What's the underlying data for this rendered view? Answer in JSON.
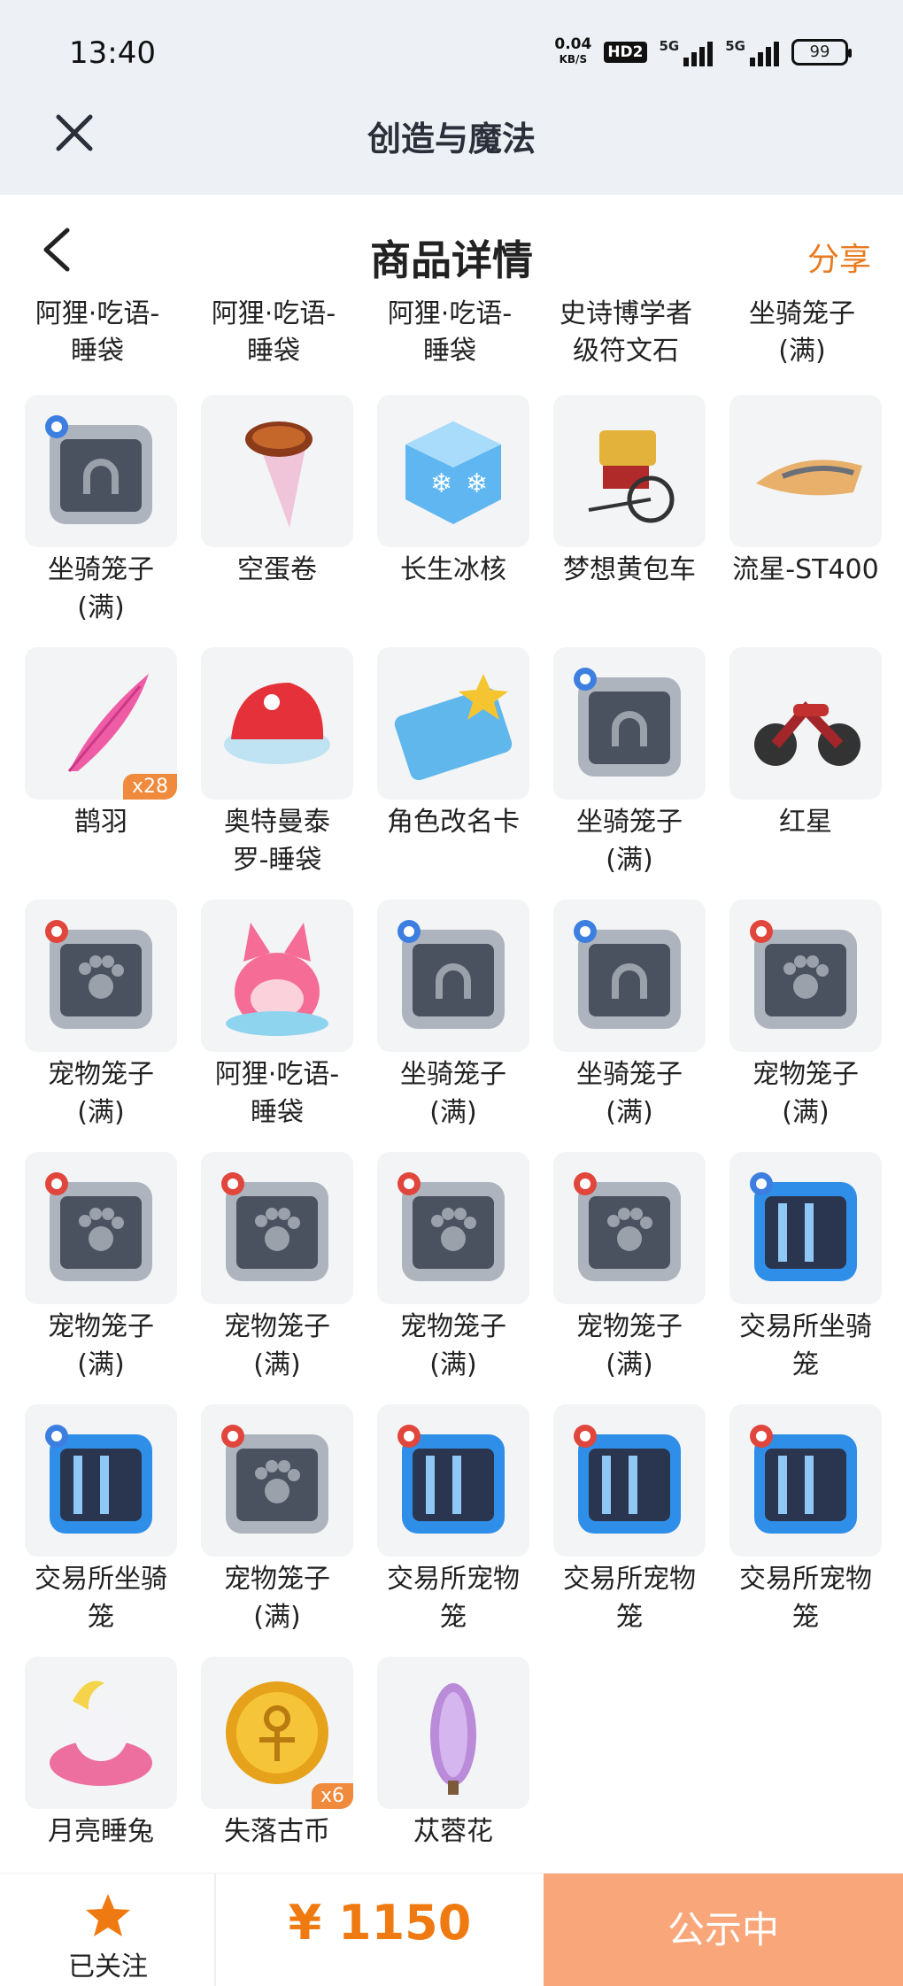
{
  "status_bar": {
    "time": "13:40",
    "net_speed_value": "0.04",
    "net_speed_unit": "KB/S",
    "hd_label": "HD2",
    "signal_1": "5G",
    "signal_2": "5G",
    "battery": "99"
  },
  "app_header": {
    "title": "创造与魔法",
    "close_icon": "close-icon"
  },
  "page_header": {
    "title": "商品详情",
    "share_label": "分享",
    "back_icon": "chevron-left-icon"
  },
  "partial_row": [
    {
      "name": "阿狸·吃语-\n睡袋"
    },
    {
      "name": "阿狸·吃语-\n睡袋"
    },
    {
      "name": "阿狸·吃语-\n睡袋"
    },
    {
      "name": "史诗博学者\n级符文石"
    },
    {
      "name": "坐骑笼子\n(满)"
    }
  ],
  "items": [
    {
      "name": "坐骑笼子\n(满)",
      "icon": "mount-cage-icon",
      "qty": ""
    },
    {
      "name": "空蛋卷",
      "icon": "ice-cream-cone-icon",
      "qty": ""
    },
    {
      "name": "长生冰核",
      "icon": "ice-cube-icon",
      "qty": ""
    },
    {
      "name": "梦想黄包车",
      "icon": "rickshaw-icon",
      "qty": ""
    },
    {
      "name": "流星-ST400",
      "icon": "hover-bike-icon",
      "qty": ""
    },
    {
      "name": "鹊羽",
      "icon": "pink-feather-icon",
      "qty": "x28"
    },
    {
      "name": "奥特曼泰\n罗-睡袋",
      "icon": "sleeping-bag-icon",
      "qty": ""
    },
    {
      "name": "角色改名卡",
      "icon": "rename-card-icon",
      "qty": ""
    },
    {
      "name": "坐骑笼子\n(满)",
      "icon": "mount-cage-icon",
      "qty": ""
    },
    {
      "name": "红星",
      "icon": "motorcycle-icon",
      "qty": ""
    },
    {
      "name": "宠物笼子\n(满)",
      "icon": "pet-cage-icon",
      "qty": ""
    },
    {
      "name": "阿狸·吃语-\n睡袋",
      "icon": "pink-fox-icon",
      "qty": ""
    },
    {
      "name": "坐骑笼子\n(满)",
      "icon": "mount-cage-icon",
      "qty": ""
    },
    {
      "name": "坐骑笼子\n(满)",
      "icon": "mount-cage-icon",
      "qty": ""
    },
    {
      "name": "宠物笼子\n(满)",
      "icon": "pet-cage-icon",
      "qty": ""
    },
    {
      "name": "宠物笼子\n(满)",
      "icon": "pet-cage-icon",
      "qty": ""
    },
    {
      "name": "宠物笼子\n(满)",
      "icon": "pet-cage-icon",
      "qty": ""
    },
    {
      "name": "宠物笼子\n(满)",
      "icon": "pet-cage-icon",
      "qty": ""
    },
    {
      "name": "宠物笼子\n(满)",
      "icon": "pet-cage-icon",
      "qty": ""
    },
    {
      "name": "交易所坐骑\n笼",
      "icon": "exchange-mount-cage-icon",
      "qty": ""
    },
    {
      "name": "交易所坐骑\n笼",
      "icon": "exchange-mount-cage-icon",
      "qty": ""
    },
    {
      "name": "宠物笼子\n(满)",
      "icon": "pet-cage-icon",
      "qty": ""
    },
    {
      "name": "交易所宠物\n笼",
      "icon": "exchange-pet-cage-icon",
      "qty": ""
    },
    {
      "name": "交易所宠物\n笼",
      "icon": "exchange-pet-cage-icon",
      "qty": ""
    },
    {
      "name": "交易所宠物\n笼",
      "icon": "exchange-pet-cage-icon",
      "qty": ""
    },
    {
      "name": "月亮睡兔",
      "icon": "moon-rabbit-icon",
      "qty": ""
    },
    {
      "name": "失落古币",
      "icon": "gold-coin-icon",
      "qty": "x6"
    },
    {
      "name": "苁蓉花",
      "icon": "purple-flower-icon",
      "qty": ""
    }
  ],
  "bottom_bar": {
    "follow_label": "已关注",
    "follow_icon": "star-icon",
    "price": "¥ 1150",
    "status_label": "公示中"
  },
  "colors": {
    "accent": "#e87a1f",
    "price": "#f07a12",
    "status_button": "#f9a77a",
    "qty_badge": "#f08a3c",
    "header_bg": "#edf1f6"
  }
}
